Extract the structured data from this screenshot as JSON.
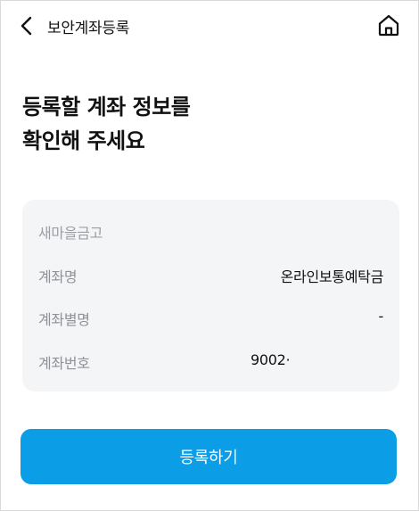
{
  "header": {
    "title": "보안계좌등록",
    "back_icon": "chevron-left-icon",
    "home_icon": "home-icon"
  },
  "heading": {
    "line1": "등록할 계좌 정보를",
    "line2": "확인해 주세요"
  },
  "account": {
    "bank": "새마을금고",
    "rows": [
      {
        "label": "계좌명",
        "value": "온라인보통예탁금"
      },
      {
        "label": "계좌별명",
        "value": "-"
      },
      {
        "label": "계좌번호",
        "value": "9002·"
      }
    ]
  },
  "actions": {
    "register_label": "등록하기"
  },
  "colors": {
    "primary": "#0b9ee6",
    "card_background": "#f4f5f7",
    "label_text": "#8e9197",
    "body_text": "#111111"
  }
}
